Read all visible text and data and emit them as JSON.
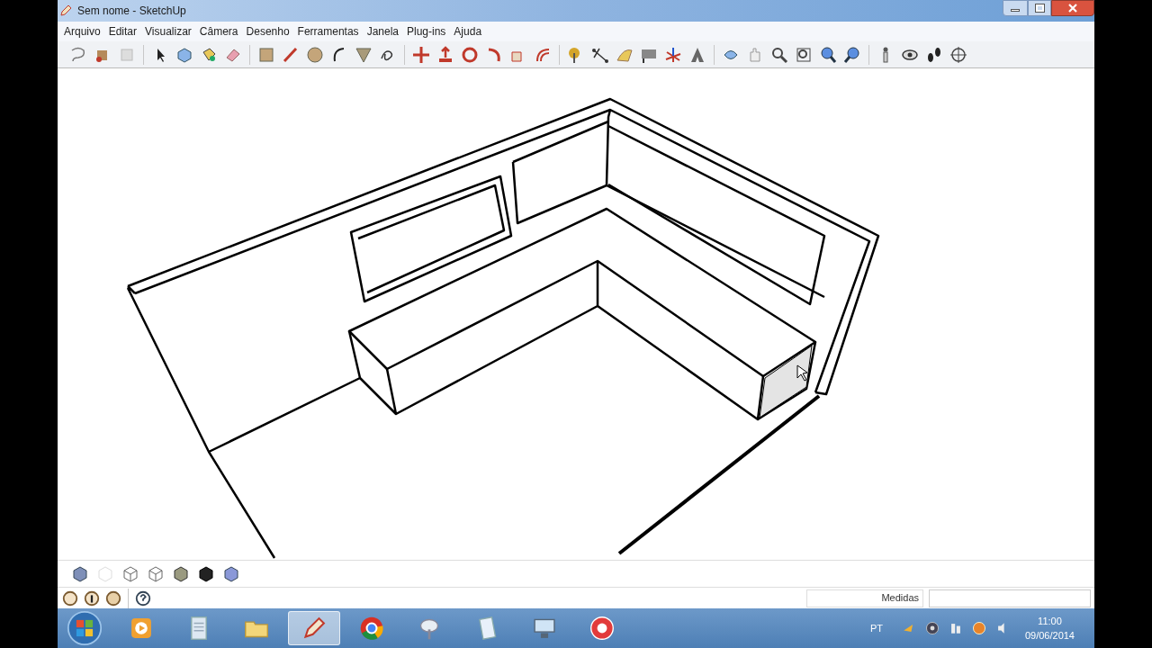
{
  "window": {
    "title": "Sem nome - SketchUp"
  },
  "menu": [
    "Arquivo",
    "Editar",
    "Visualizar",
    "Câmera",
    "Desenho",
    "Ferramentas",
    "Janela",
    "Plug-ins",
    "Ajuda"
  ],
  "status_bar": {
    "measurements_label": "Medidas"
  },
  "taskbar": {
    "apps": [
      {
        "kind": "media",
        "selected": false
      },
      {
        "kind": "notepad",
        "selected": false
      },
      {
        "kind": "folder",
        "selected": false
      },
      {
        "kind": "sketchup",
        "selected": true
      },
      {
        "kind": "browser",
        "selected": false
      },
      {
        "kind": "satellite",
        "selected": false
      },
      {
        "kind": "document",
        "selected": false
      },
      {
        "kind": "network",
        "selected": false
      },
      {
        "kind": "recorder",
        "selected": false
      }
    ],
    "language": "PT",
    "time": "11:00",
    "date": "09/06/2014"
  }
}
